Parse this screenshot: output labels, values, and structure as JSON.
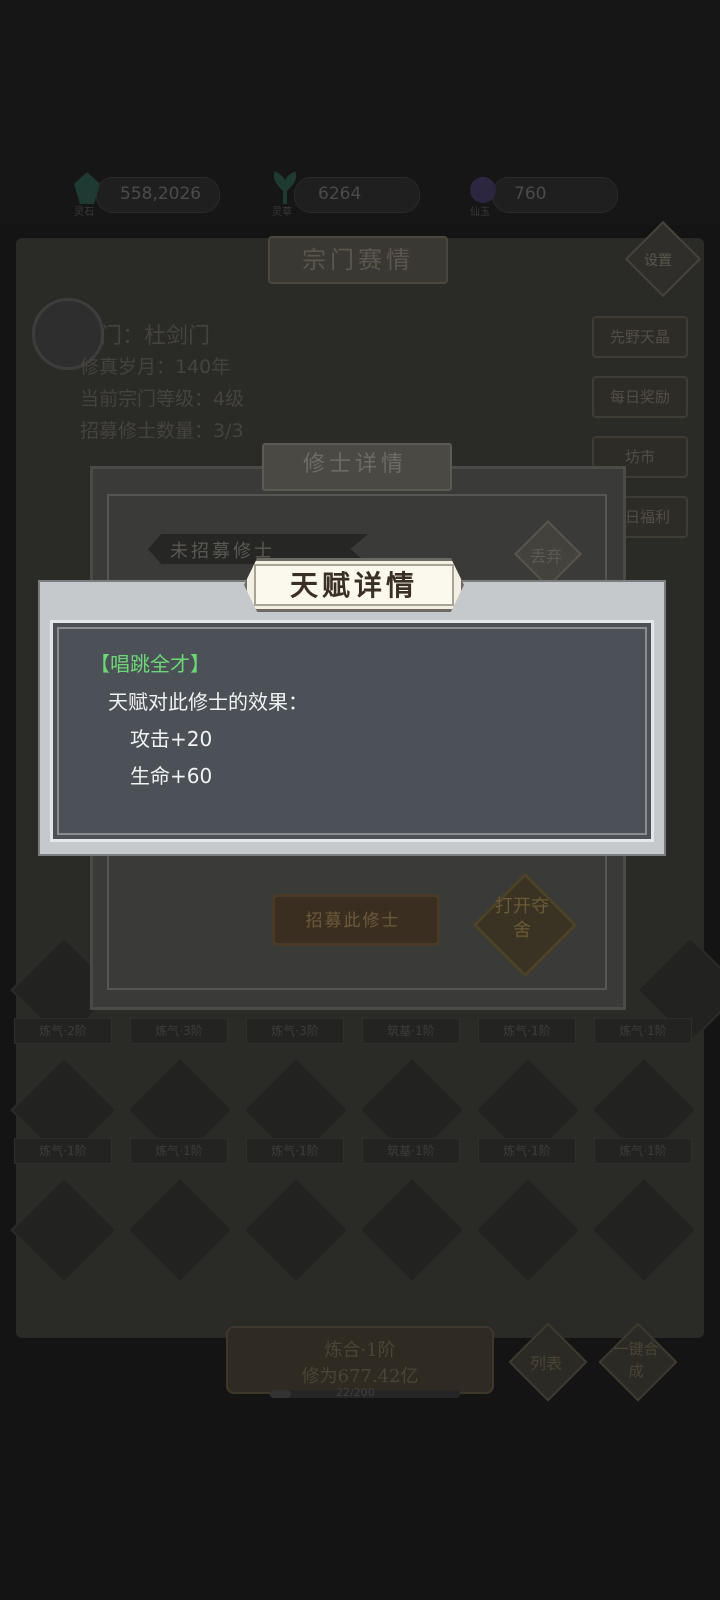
{
  "resources": [
    {
      "icon": "green-crystal-icon",
      "value": "558,2026",
      "caption": "灵石"
    },
    {
      "icon": "green-herb-icon",
      "value": "6264",
      "caption": "灵草"
    },
    {
      "icon": "purple-crystal-icon",
      "value": "760",
      "caption": "仙玉"
    }
  ],
  "sect_panel": {
    "title": "宗门赛情",
    "settings_label": "设置",
    "sect_name": "门：杜剑门",
    "lines": [
      "修真岁月：140年",
      "当前宗门等级：4级",
      "招募修士数量：3/3"
    ],
    "side_buttons": [
      "先野天晶",
      "每日奖励",
      "坊市",
      "每日福利"
    ]
  },
  "slots": {
    "row1_labels": [
      "炼气·2阶",
      "炼气·3阶",
      "炼气·3阶",
      "筑基·1阶",
      "炼气·1阶",
      "炼气·1阶"
    ],
    "row2_labels": [
      "炼气·1阶",
      "炼气·1阶",
      "炼气·1阶",
      "筑基·1阶",
      "炼气·1阶",
      "炼气·1阶"
    ]
  },
  "bottom": {
    "main_line1": "炼合·1阶",
    "main_line2": "修为677.42亿",
    "list_label": "列表",
    "one_key_label": "一键合成",
    "progress_text": "22/200",
    "progress_fraction": 0.11
  },
  "recruit_dialog": {
    "title": "修士详情",
    "ribbon": "未招募修士",
    "discard_label": "丢弃",
    "recruit_button": "招募此修士",
    "open_button": "打开夺舍"
  },
  "talent_dialog": {
    "title": "天赋详情",
    "talent_name": "【唱跳全才】",
    "effect_header": "天赋对此修士的效果：",
    "effects": [
      "攻击+20",
      "生命+60"
    ]
  }
}
